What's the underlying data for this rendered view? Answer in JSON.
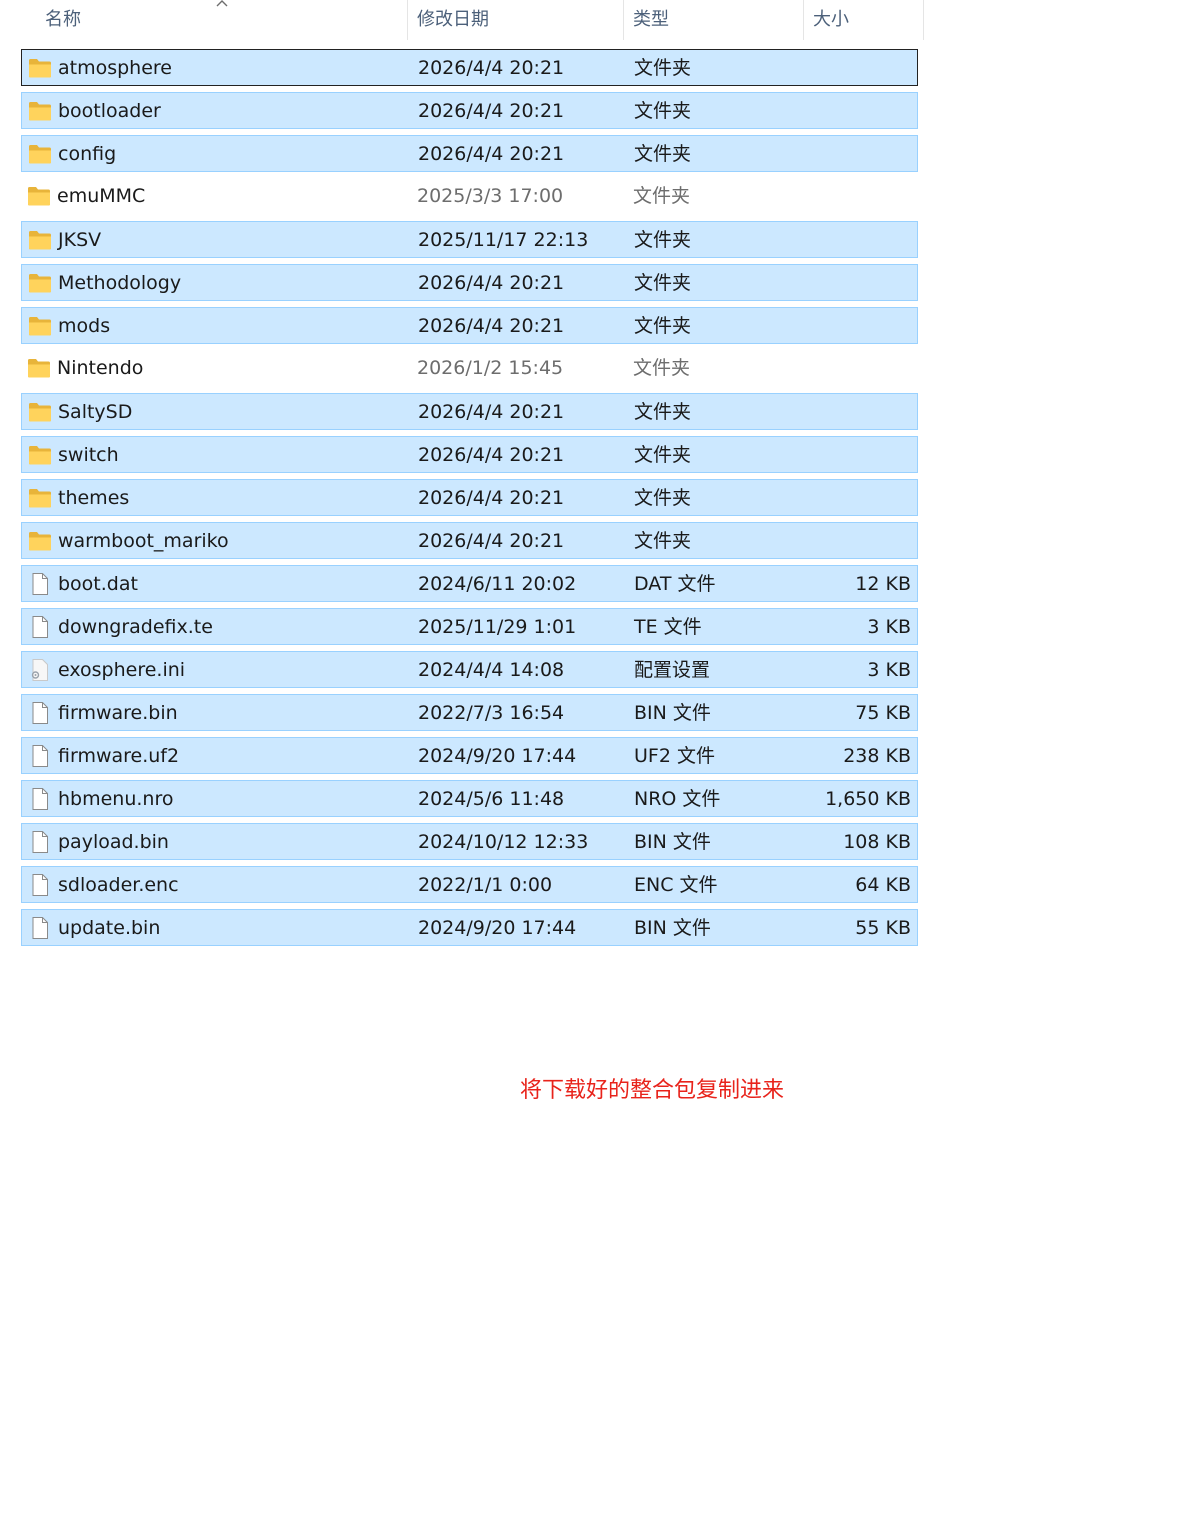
{
  "columns": {
    "name": "名称",
    "date": "修改日期",
    "type": "类型",
    "size": "大小"
  },
  "rows": [
    {
      "name": "atmosphere",
      "date": "2026/4/4 20:21",
      "type": "文件夹",
      "size": "",
      "icon": "folder-icon",
      "selected": true,
      "focused": true
    },
    {
      "name": "bootloader",
      "date": "2026/4/4 20:21",
      "type": "文件夹",
      "size": "",
      "icon": "folder-icon",
      "selected": true
    },
    {
      "name": "config",
      "date": "2026/4/4 20:21",
      "type": "文件夹",
      "size": "",
      "icon": "folder-icon",
      "selected": true
    },
    {
      "name": "emuMMC",
      "date": "2025/3/3 17:00",
      "type": "文件夹",
      "size": "",
      "icon": "folder-icon",
      "selected": false
    },
    {
      "name": "JKSV",
      "date": "2025/11/17 22:13",
      "type": "文件夹",
      "size": "",
      "icon": "folder-icon",
      "selected": true
    },
    {
      "name": "Methodology",
      "date": "2026/4/4 20:21",
      "type": "文件夹",
      "size": "",
      "icon": "folder-icon",
      "selected": true
    },
    {
      "name": "mods",
      "date": "2026/4/4 20:21",
      "type": "文件夹",
      "size": "",
      "icon": "folder-icon",
      "selected": true
    },
    {
      "name": "Nintendo",
      "date": "2026/1/2 15:45",
      "type": "文件夹",
      "size": "",
      "icon": "folder-icon",
      "selected": false
    },
    {
      "name": "SaltySD",
      "date": "2026/4/4 20:21",
      "type": "文件夹",
      "size": "",
      "icon": "folder-icon",
      "selected": true
    },
    {
      "name": "switch",
      "date": "2026/4/4 20:21",
      "type": "文件夹",
      "size": "",
      "icon": "folder-icon",
      "selected": true
    },
    {
      "name": "themes",
      "date": "2026/4/4 20:21",
      "type": "文件夹",
      "size": "",
      "icon": "folder-icon",
      "selected": true
    },
    {
      "name": "warmboot_mariko",
      "date": "2026/4/4 20:21",
      "type": "文件夹",
      "size": "",
      "icon": "folder-icon",
      "selected": true
    },
    {
      "name": "boot.dat",
      "date": "2024/6/11 20:02",
      "type": "DAT 文件",
      "size": "12 KB",
      "icon": "file-icon",
      "selected": true
    },
    {
      "name": "downgradefix.te",
      "date": "2025/11/29 1:01",
      "type": "TE 文件",
      "size": "3 KB",
      "icon": "file-icon",
      "selected": true
    },
    {
      "name": "exosphere.ini",
      "date": "2024/4/4 14:08",
      "type": "配置设置",
      "size": "3 KB",
      "icon": "settings-file-icon",
      "selected": true
    },
    {
      "name": "firmware.bin",
      "date": "2022/7/3 16:54",
      "type": "BIN 文件",
      "size": "75 KB",
      "icon": "file-icon",
      "selected": true
    },
    {
      "name": "firmware.uf2",
      "date": "2024/9/20 17:44",
      "type": "UF2 文件",
      "size": "238 KB",
      "icon": "file-icon",
      "selected": true
    },
    {
      "name": "hbmenu.nro",
      "date": "2024/5/6 11:48",
      "type": "NRO 文件",
      "size": "1,650 KB",
      "icon": "file-icon",
      "selected": true
    },
    {
      "name": "payload.bin",
      "date": "2024/10/12 12:33",
      "type": "BIN 文件",
      "size": "108 KB",
      "icon": "file-icon",
      "selected": true
    },
    {
      "name": "sdloader.enc",
      "date": "2022/1/1 0:00",
      "type": "ENC 文件",
      "size": "64 KB",
      "icon": "file-icon",
      "selected": true
    },
    {
      "name": "update.bin",
      "date": "2024/9/20 17:44",
      "type": "BIN 文件",
      "size": "55 KB",
      "icon": "file-icon",
      "selected": true
    }
  ],
  "annotation": "将下载好的整合包复制进来",
  "colors": {
    "selection": "#cce8ff",
    "selection_border": "#99d1ff",
    "annotation": "#e8231b"
  }
}
